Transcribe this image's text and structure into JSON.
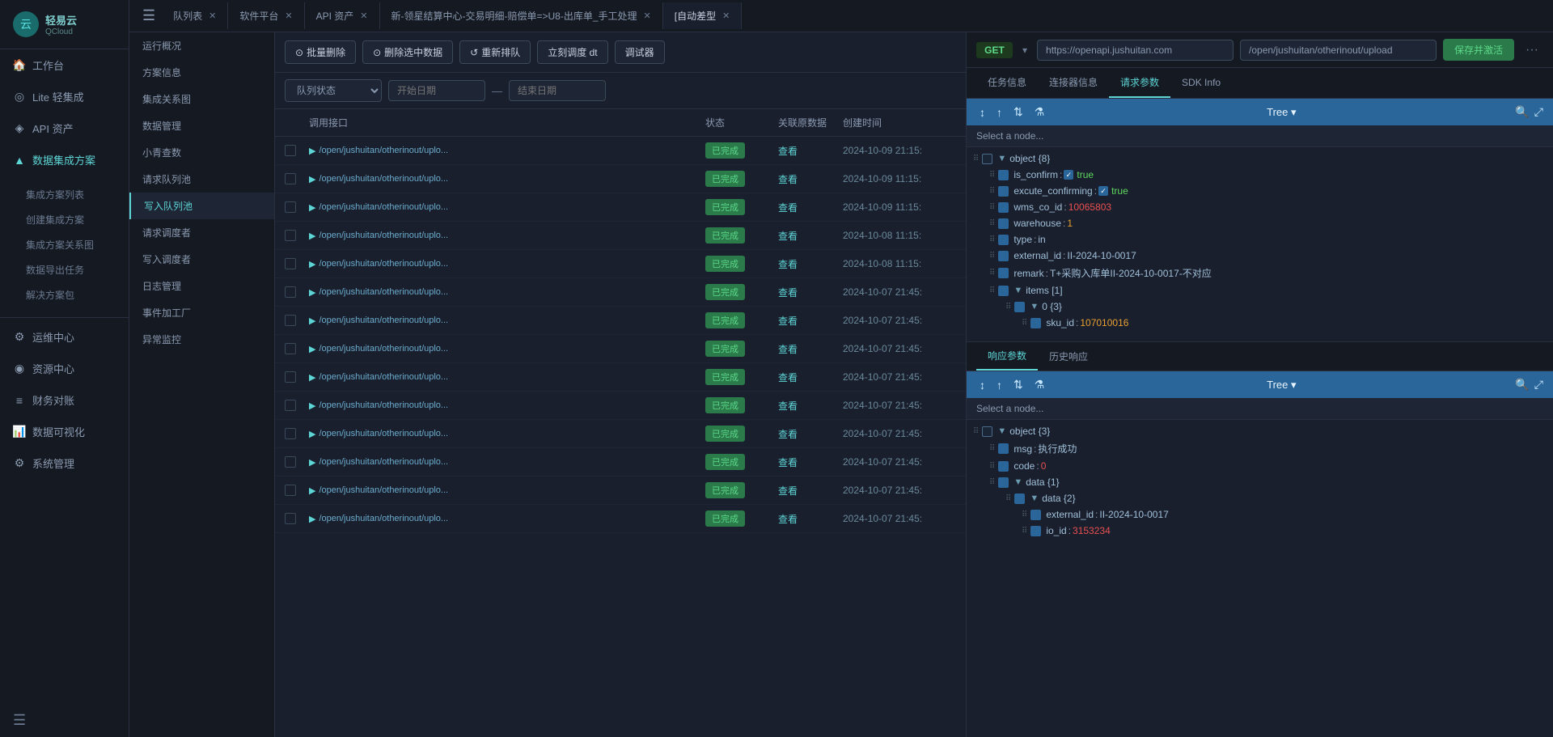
{
  "sidebar": {
    "logo_text": "轻易云",
    "logo_sub": "QCloud",
    "items": [
      {
        "label": "工作台",
        "icon": "🏠",
        "active": false
      },
      {
        "label": "Lite 轻集成",
        "icon": "◎",
        "active": false
      },
      {
        "label": "API 资产",
        "icon": "◈",
        "active": false
      },
      {
        "label": "数据集成方案",
        "icon": "▲",
        "active": true
      },
      {
        "label": "运维中心",
        "icon": "⚙",
        "active": false
      },
      {
        "label": "资源中心",
        "icon": "◉",
        "active": false
      },
      {
        "label": "财务对账",
        "icon": "≡",
        "active": false
      },
      {
        "label": "数据可视化",
        "icon": "📊",
        "active": false
      },
      {
        "label": "系统管理",
        "icon": "⚙",
        "active": false
      }
    ],
    "sub_items": [
      {
        "label": "集成方案列表",
        "active": false
      },
      {
        "label": "创建集成方案",
        "active": false
      },
      {
        "label": "集成方案关系图",
        "active": false
      },
      {
        "label": "数据导出任务",
        "active": false
      },
      {
        "label": "解决方案包",
        "active": false
      }
    ]
  },
  "tabs": [
    {
      "label": "队列表",
      "active": false,
      "closable": true
    },
    {
      "label": "软件平台",
      "active": false,
      "closable": true
    },
    {
      "label": "API 资产",
      "active": false,
      "closable": true
    },
    {
      "label": "新-领星结算中心-交易明细-赔偿单=>U8-出库单_手工处理",
      "active": false,
      "closable": true
    },
    {
      "label": "[自动差型",
      "active": true,
      "closable": true
    }
  ],
  "left_col": {
    "sections": [
      {
        "label": "运行概况"
      },
      {
        "label": "方案信息"
      },
      {
        "label": "集成关系图"
      },
      {
        "label": "数据管理"
      },
      {
        "label": "小青查数"
      },
      {
        "label": "请求队列池"
      },
      {
        "label": "写入队列池",
        "active": true
      },
      {
        "label": "请求调度者"
      },
      {
        "label": "写入调度者"
      },
      {
        "label": "日志管理"
      },
      {
        "label": "事件加工厂"
      },
      {
        "label": "异常监控"
      }
    ]
  },
  "queue_actions": {
    "batch_delete": "批量删除",
    "delete_selected": "删除选中数据",
    "re_queue": "重新排队",
    "schedule_dt": "立刻调度 dt",
    "debug": "调试器"
  },
  "filter": {
    "status_placeholder": "队列状态",
    "start_placeholder": "开始日期",
    "end_placeholder": "结束日期",
    "separator": "—"
  },
  "table": {
    "headers": [
      "",
      "调用接口",
      "状态",
      "关联原数据",
      "创建时间"
    ],
    "rows": [
      {
        "url": "/open/jushuitan/otherinout/uplo...",
        "status": "已完成",
        "ref": "查看",
        "time": "2024-10-09 21:15:"
      },
      {
        "url": "/open/jushuitan/otherinout/uplo...",
        "status": "已完成",
        "ref": "查看",
        "time": "2024-10-09 11:15:"
      },
      {
        "url": "/open/jushuitan/otherinout/uplo...",
        "status": "已完成",
        "ref": "查看",
        "time": "2024-10-09 11:15:"
      },
      {
        "url": "/open/jushuitan/otherinout/uplo...",
        "status": "已完成",
        "ref": "查看",
        "time": "2024-10-08 11:15:"
      },
      {
        "url": "/open/jushuitan/otherinout/uplo...",
        "status": "已完成",
        "ref": "查看",
        "time": "2024-10-08 11:15:"
      },
      {
        "url": "/open/jushuitan/otherinout/uplo...",
        "status": "已完成",
        "ref": "查看",
        "time": "2024-10-07 21:45:"
      },
      {
        "url": "/open/jushuitan/otherinout/uplo...",
        "status": "已完成",
        "ref": "查看",
        "time": "2024-10-07 21:45:"
      },
      {
        "url": "/open/jushuitan/otherinout/uplo...",
        "status": "已完成",
        "ref": "查看",
        "time": "2024-10-07 21:45:"
      },
      {
        "url": "/open/jushuitan/otherinout/uplo...",
        "status": "已完成",
        "ref": "查看",
        "time": "2024-10-07 21:45:"
      },
      {
        "url": "/open/jushuitan/otherinout/uplo...",
        "status": "已完成",
        "ref": "查看",
        "time": "2024-10-07 21:45:"
      },
      {
        "url": "/open/jushuitan/otherinout/uplo...",
        "status": "已完成",
        "ref": "查看",
        "time": "2024-10-07 21:45:"
      },
      {
        "url": "/open/jushuitan/otherinout/uplo...",
        "status": "已完成",
        "ref": "查看",
        "time": "2024-10-07 21:45:"
      },
      {
        "url": "/open/jushuitan/otherinout/uplo...",
        "status": "已完成",
        "ref": "查看",
        "time": "2024-10-07 21:45:"
      },
      {
        "url": "/open/jushuitan/otherinout/uplo...",
        "status": "已完成",
        "ref": "查看",
        "time": "2024-10-07 21:45:"
      }
    ]
  },
  "api": {
    "method": "GET",
    "url_base": "https://openapi.jushuitan.com",
    "url_path": "/open/jushuitan/otherinout/upload",
    "save_btn": "保存并激活",
    "tabs": [
      "任务信息",
      "连接器信息",
      "请求参数",
      "SDK Info"
    ],
    "active_tab": "请求参数"
  },
  "request_tree": {
    "toolbar_label": "Tree ▾",
    "select_placeholder": "Select a node...",
    "nodes": [
      {
        "level": 0,
        "key": "object {8}",
        "arrow": "▼",
        "indent": 0
      },
      {
        "level": 1,
        "key": "is_confirm",
        "val": "true",
        "val_type": "bool_check",
        "indent": 1
      },
      {
        "level": 1,
        "key": "excute_confirming",
        "val": "true",
        "val_type": "bool_check",
        "indent": 1
      },
      {
        "level": 1,
        "key": "wms_co_id",
        "val": "10065803",
        "val_type": "red",
        "indent": 1
      },
      {
        "level": 1,
        "key": "warehouse",
        "val": "1",
        "val_type": "num",
        "indent": 1
      },
      {
        "level": 1,
        "key": "type",
        "val": "in",
        "val_type": "str",
        "indent": 1
      },
      {
        "level": 1,
        "key": "external_id",
        "val": "II-2024-10-0017",
        "val_type": "str",
        "indent": 1
      },
      {
        "level": 1,
        "key": "remark",
        "val": "T+采购入库单II-2024-10-0017-不对应",
        "val_type": "str",
        "indent": 1
      },
      {
        "level": 1,
        "key": "items [1]",
        "arrow": "▼",
        "indent": 1
      },
      {
        "level": 2,
        "key": "0 {3}",
        "arrow": "▼",
        "indent": 2
      },
      {
        "level": 3,
        "key": "sku_id",
        "val": "107010016",
        "val_type": "num",
        "indent": 3
      }
    ]
  },
  "response_tabs": [
    "响应参数",
    "历史响应"
  ],
  "response_tree": {
    "toolbar_label": "Tree ▾",
    "select_placeholder": "Select a node...",
    "nodes": [
      {
        "level": 0,
        "key": "object {3}",
        "arrow": "▼",
        "indent": 0
      },
      {
        "level": 1,
        "key": "msg",
        "val": "执行成功",
        "val_type": "str",
        "indent": 1
      },
      {
        "level": 1,
        "key": "code",
        "val": "0",
        "val_type": "num_zero",
        "indent": 1
      },
      {
        "level": 1,
        "key": "data {1}",
        "arrow": "▼",
        "indent": 1
      },
      {
        "level": 2,
        "key": "data {2}",
        "arrow": "▼",
        "indent": 2
      },
      {
        "level": 3,
        "key": "external_id",
        "val": "II-2024-10-0017",
        "val_type": "str",
        "indent": 3
      },
      {
        "level": 3,
        "key": "io_id",
        "val": "3153234",
        "val_type": "red",
        "indent": 3
      }
    ]
  }
}
